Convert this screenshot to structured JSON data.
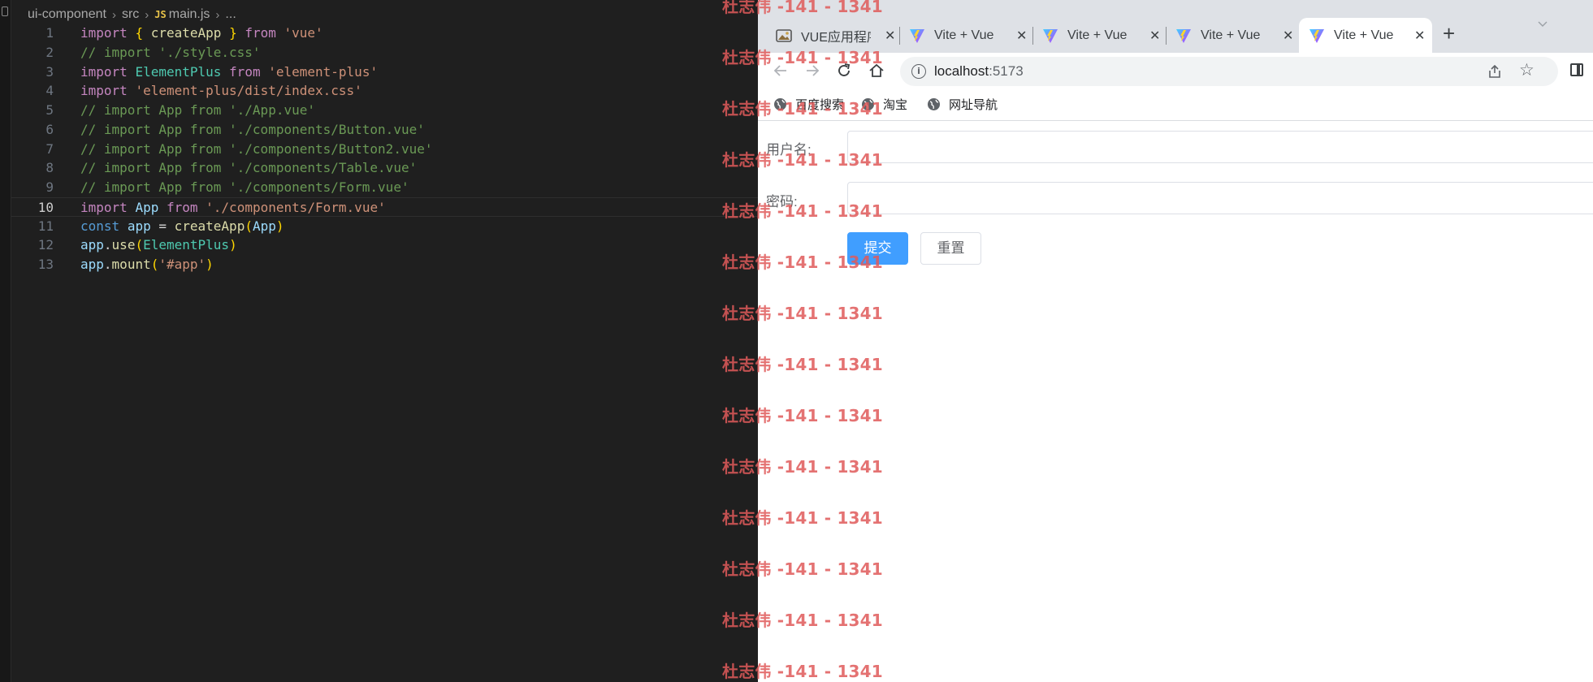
{
  "editor": {
    "breadcrumb": [
      "ui-component",
      "src",
      "main.js",
      "..."
    ],
    "breadcrumb_file_badge": "JS",
    "current_line": 10,
    "lines": [
      {
        "n": "1",
        "tokens": [
          [
            "kw",
            "import"
          ],
          [
            "pl",
            " "
          ],
          [
            "br1",
            "{"
          ],
          [
            "pl",
            " "
          ],
          [
            "fn",
            "createApp"
          ],
          [
            "pl",
            " "
          ],
          [
            "br1",
            "}"
          ],
          [
            "pl",
            " "
          ],
          [
            "kw",
            "from"
          ],
          [
            "pl",
            " "
          ],
          [
            "str",
            "'vue'"
          ]
        ]
      },
      {
        "n": "2",
        "tokens": [
          [
            "cm",
            "// import './style.css'"
          ]
        ]
      },
      {
        "n": "3",
        "tokens": [
          [
            "kw",
            "import"
          ],
          [
            "pl",
            " "
          ],
          [
            "cls",
            "ElementPlus"
          ],
          [
            "pl",
            " "
          ],
          [
            "kw",
            "from"
          ],
          [
            "pl",
            " "
          ],
          [
            "str",
            "'element-plus'"
          ]
        ]
      },
      {
        "n": "4",
        "tokens": [
          [
            "kw",
            "import"
          ],
          [
            "pl",
            " "
          ],
          [
            "str",
            "'element-plus/dist/index.css'"
          ]
        ]
      },
      {
        "n": "5",
        "tokens": [
          [
            "cm",
            "// import App from './App.vue'"
          ]
        ]
      },
      {
        "n": "6",
        "tokens": [
          [
            "cm",
            "// import App from './components/Button.vue'"
          ]
        ]
      },
      {
        "n": "7",
        "tokens": [
          [
            "cm",
            "// import App from './components/Button2.vue'"
          ]
        ]
      },
      {
        "n": "8",
        "tokens": [
          [
            "cm",
            "// import App from './components/Table.vue'"
          ]
        ]
      },
      {
        "n": "9",
        "tokens": [
          [
            "cm",
            "// import App from './components/Form.vue'"
          ]
        ]
      },
      {
        "n": "10",
        "tokens": [
          [
            "kw",
            "import"
          ],
          [
            "pl",
            " "
          ],
          [
            "var",
            "App"
          ],
          [
            "pl",
            " "
          ],
          [
            "kw",
            "from"
          ],
          [
            "pl",
            " "
          ],
          [
            "str",
            "'./components/Form.vue'"
          ]
        ]
      },
      {
        "n": "11",
        "tokens": [
          [
            "decl",
            "const"
          ],
          [
            "pl",
            " "
          ],
          [
            "var",
            "app"
          ],
          [
            "pl",
            " = "
          ],
          [
            "fn",
            "createApp"
          ],
          [
            "br1",
            "("
          ],
          [
            "var",
            "App"
          ],
          [
            "br1",
            ")"
          ]
        ]
      },
      {
        "n": "12",
        "tokens": [
          [
            "var",
            "app"
          ],
          [
            "pl",
            "."
          ],
          [
            "fn",
            "use"
          ],
          [
            "br1",
            "("
          ],
          [
            "cls",
            "ElementPlus"
          ],
          [
            "br1",
            ")"
          ]
        ]
      },
      {
        "n": "13",
        "tokens": [
          [
            "var",
            "app"
          ],
          [
            "pl",
            "."
          ],
          [
            "fn",
            "mount"
          ],
          [
            "br1",
            "("
          ],
          [
            "str",
            "'#app'"
          ],
          [
            "br1",
            ")"
          ]
        ]
      }
    ]
  },
  "browser": {
    "tabs": [
      {
        "title": "VUE应用程序",
        "icon": "image-favicon-icon",
        "active": false
      },
      {
        "title": "Vite + Vue",
        "icon": "vite-logo-icon",
        "active": false
      },
      {
        "title": "Vite + Vue",
        "icon": "vite-logo-icon",
        "active": false
      },
      {
        "title": "Vite + Vue",
        "icon": "vite-logo-icon",
        "active": false
      },
      {
        "title": "Vite + Vue",
        "icon": "vite-logo-icon",
        "active": true
      }
    ],
    "tab_close_glyph": "✕",
    "new_tab_glyph": "+",
    "address": {
      "host": "localhost",
      "port": ":5173"
    },
    "bookmarks": [
      "百度搜索",
      "淘宝",
      "网址导航"
    ],
    "form": {
      "username_label": "用户名:",
      "password_label": "密码:",
      "submit_label": "提交",
      "reset_label": "重置"
    }
  },
  "watermark": {
    "text": "杜志伟 -141 - 1341",
    "color": "#e05a5a"
  }
}
